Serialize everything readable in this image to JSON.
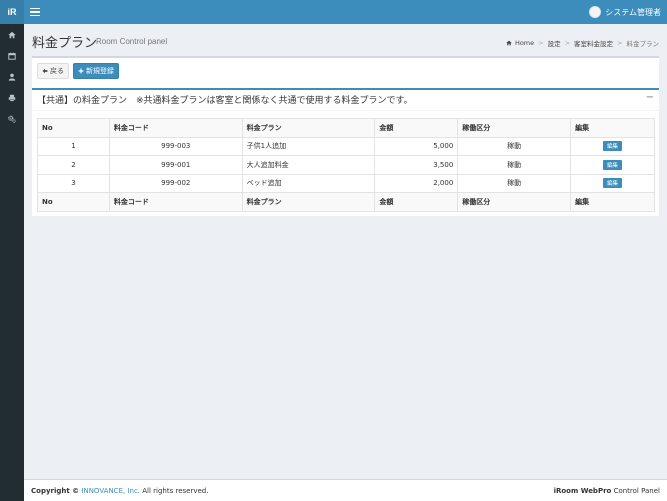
{
  "header": {
    "logo_text": "iR",
    "user_name": "システム管理者"
  },
  "sidebar": {
    "items": [
      {
        "icon": "home-icon"
      },
      {
        "icon": "calendar-icon"
      },
      {
        "icon": "user-icon"
      },
      {
        "icon": "print-icon"
      },
      {
        "icon": "cogs-icon"
      }
    ]
  },
  "page": {
    "title": "料金プラン",
    "subtitle": "Room Control panel"
  },
  "breadcrumb": {
    "home": "Home",
    "settings": "設定",
    "room_rate": "客室料金設定",
    "current": "料金プラン"
  },
  "toolbar": {
    "back_label": "戻る",
    "new_label": "新規登録"
  },
  "box": {
    "title": "【共通】の料金プラン　※共通料金プランは客室と関係なく共通で使用する料金プランです。",
    "collapse": "−"
  },
  "table": {
    "headers": [
      "No",
      "料金コード",
      "料金プラン",
      "金額",
      "稼働区分",
      "編集"
    ],
    "rows": [
      {
        "no": "1",
        "code": "999-003",
        "plan": "子供1人追加",
        "amount": "5,000",
        "status": "稼動",
        "edit": "編集"
      },
      {
        "no": "2",
        "code": "999-001",
        "plan": "大人追加料金",
        "amount": "3,500",
        "status": "稼動",
        "edit": "編集"
      },
      {
        "no": "3",
        "code": "999-002",
        "plan": "ベッド追加",
        "amount": "2,000",
        "status": "稼動",
        "edit": "編集"
      }
    ]
  },
  "footer": {
    "copyright_label": "Copyright ©",
    "company": "INNOVANCE, Inc.",
    "rights": "All rights reserved.",
    "product_bold": "iRoom WebPro",
    "product_rest": "Control Panel"
  },
  "colors": {
    "primary": "#3c8dbc",
    "sidebar": "#222d32"
  }
}
